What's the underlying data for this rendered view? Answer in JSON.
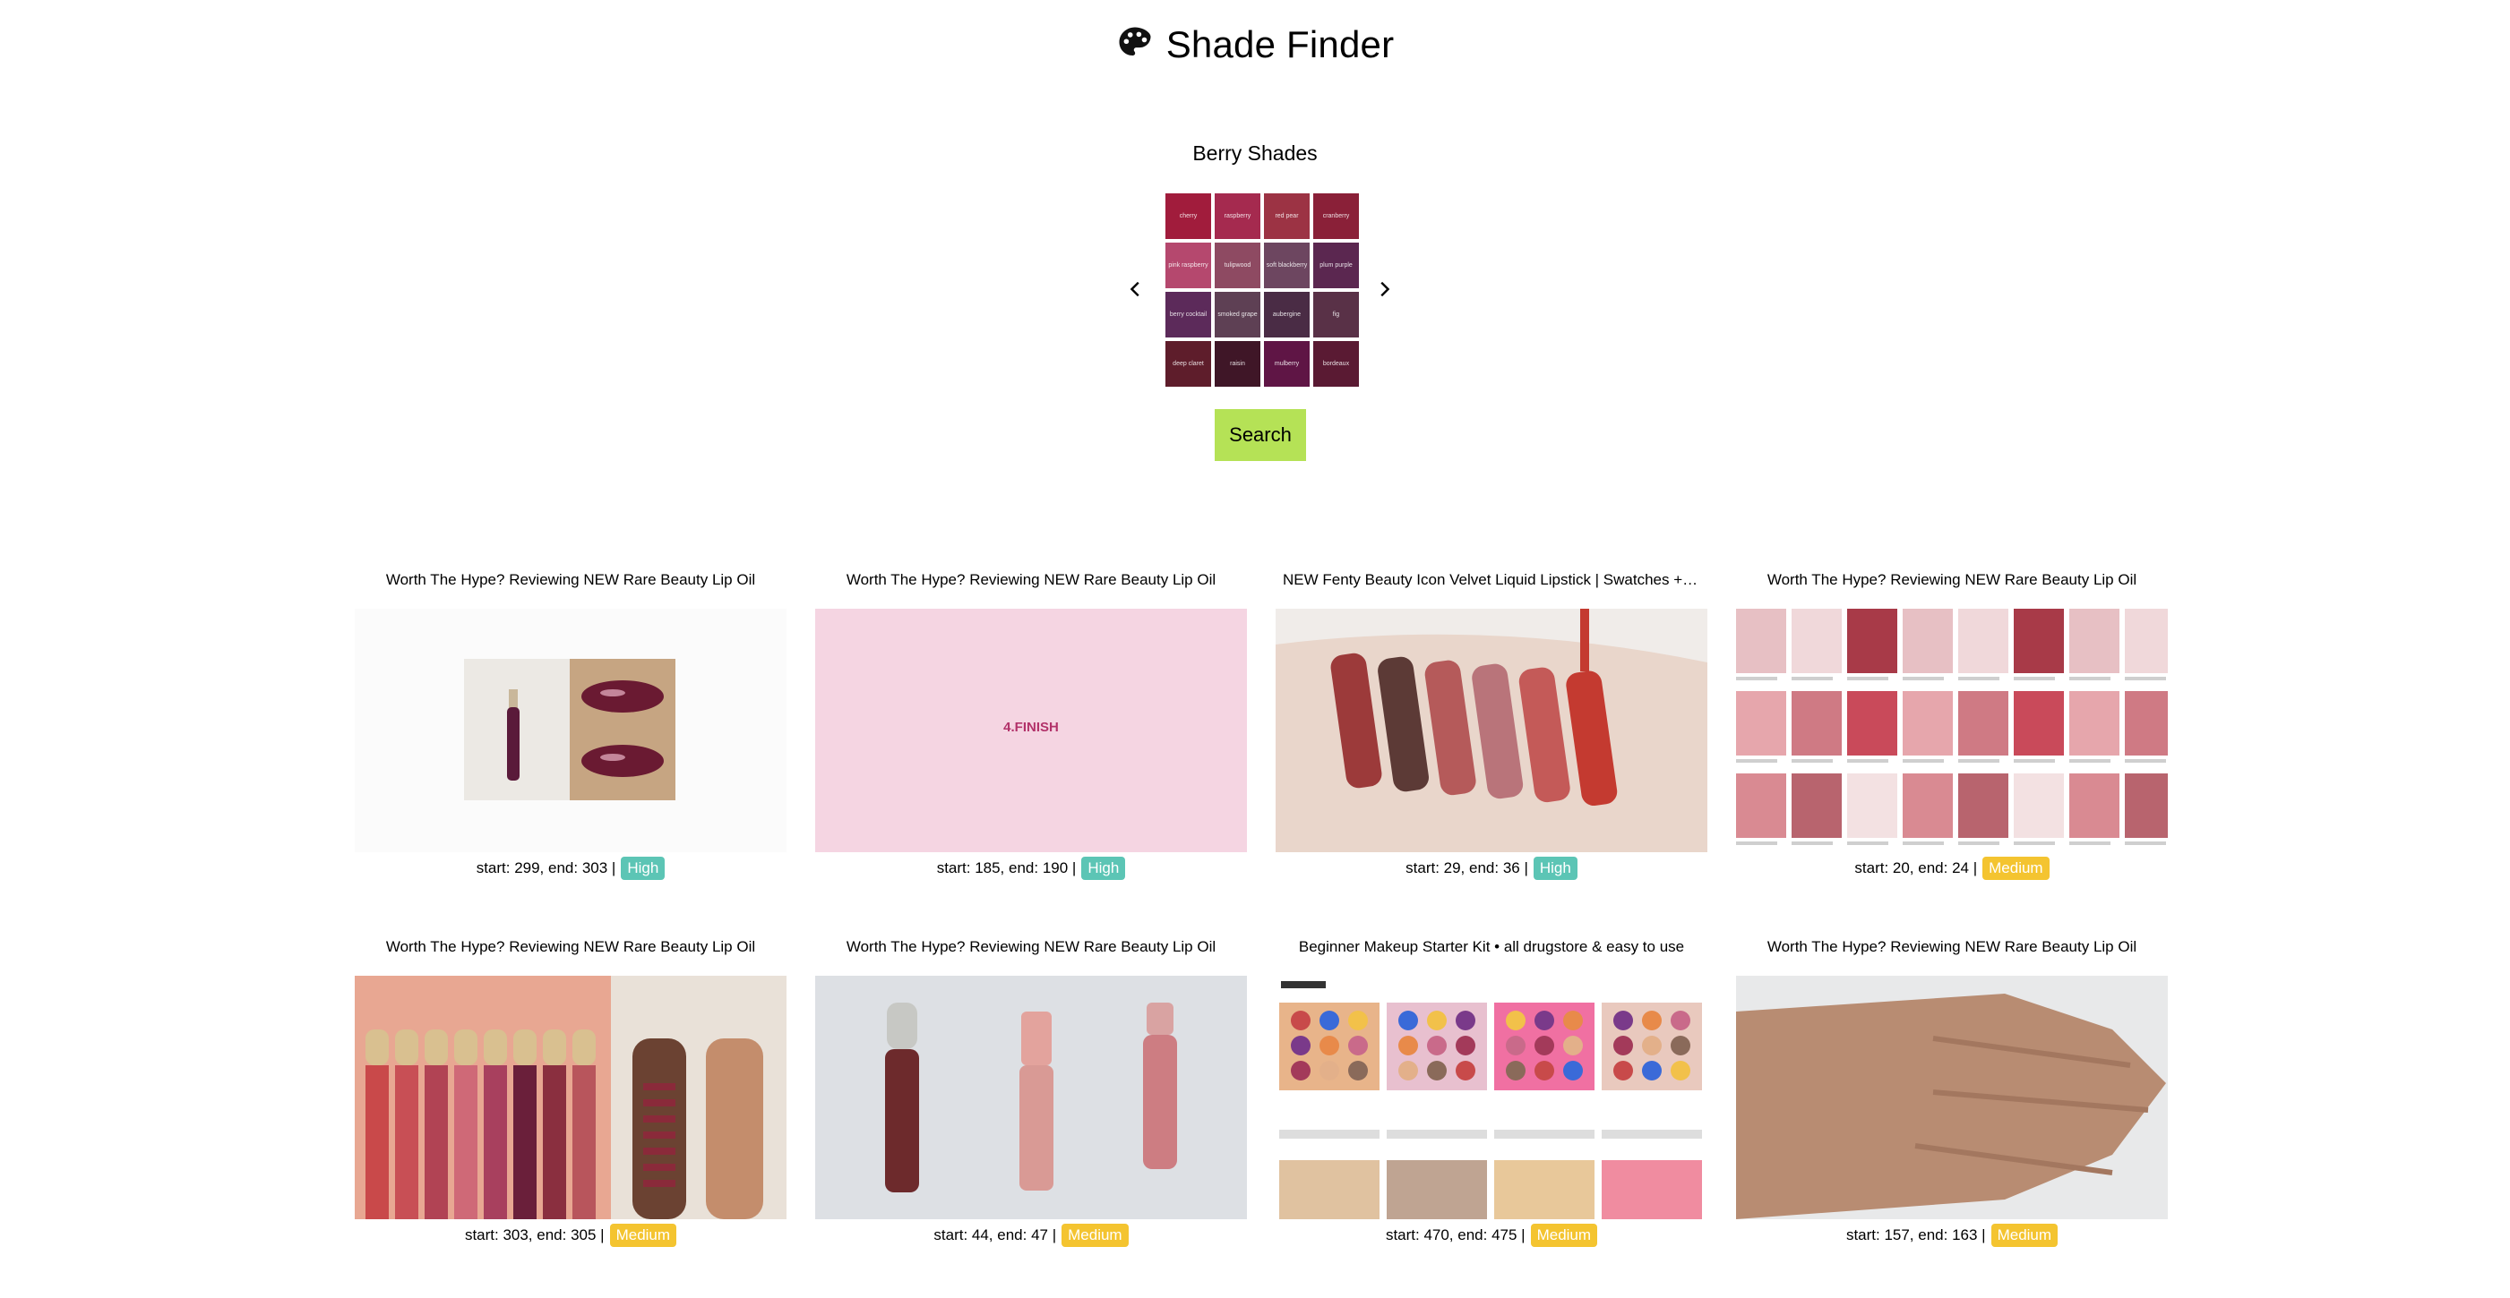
{
  "header": {
    "title": "Shade Finder",
    "icon": "palette-icon"
  },
  "palette": {
    "title": "Berry Shades",
    "swatches": [
      {
        "label": "cherry",
        "color": "#a11c3c"
      },
      {
        "label": "raspberry",
        "color": "#a52a4f"
      },
      {
        "label": "red pear",
        "color": "#9c3344"
      },
      {
        "label": "cranberry",
        "color": "#8a2038"
      },
      {
        "label": "pink raspberry",
        "color": "#b5486e"
      },
      {
        "label": "tulipwood",
        "color": "#8e4a62"
      },
      {
        "label": "soft blackberry",
        "color": "#6d4660"
      },
      {
        "label": "plum purple",
        "color": "#5b2750"
      },
      {
        "label": "berry cocktail",
        "color": "#5c2a5a"
      },
      {
        "label": "smoked grape",
        "color": "#5e4054"
      },
      {
        "label": "aubergine",
        "color": "#4a2c45"
      },
      {
        "label": "fig",
        "color": "#593147"
      },
      {
        "label": "deep claret",
        "color": "#5e1d2b"
      },
      {
        "label": "raisin",
        "color": "#3f1627"
      },
      {
        "label": "mulberry",
        "color": "#5f1545"
      },
      {
        "label": "bordeaux",
        "color": "#5a1a33"
      }
    ]
  },
  "search": {
    "label": "Search"
  },
  "badge_colors": {
    "High": "#5cc5b5",
    "Medium": "#f4c430"
  },
  "results": [
    {
      "title": "Worth The Hype? Reviewing NEW Rare Beauty Lip Oil",
      "meta": "start: 299, end: 303 |",
      "confidence": "High",
      "thumb": "rare-beauty-lip-oil-tube-and-lips"
    },
    {
      "title": "Worth The Hype? Reviewing NEW Rare Beauty Lip Oil",
      "meta": "start: 185, end: 190 |",
      "confidence": "High",
      "thumb": "finish-pink-slide",
      "thumb_text": "4.FINISH"
    },
    {
      "title": "NEW Fenty Beauty Icon Velvet Liquid Lipstick | Swatches + De...",
      "meta": "start: 29, end: 36 |",
      "confidence": "High",
      "thumb": "arm-lipstick-swatches"
    },
    {
      "title": "Worth The Hype? Reviewing NEW Rare Beauty Lip Oil",
      "meta": "start: 20, end: 24 |",
      "confidence": "Medium",
      "thumb": "image-search-grid"
    },
    {
      "title": "Worth The Hype? Reviewing NEW Rare Beauty Lip Oil",
      "meta": "start: 303, end: 305 |",
      "confidence": "Medium",
      "thumb": "rare-beauty-lineup-and-arm-swatches"
    },
    {
      "title": "Worth The Hype? Reviewing NEW Rare Beauty Lip Oil",
      "meta": "start: 44, end: 47 |",
      "confidence": "Medium",
      "thumb": "three-lip-gloss-tubes"
    },
    {
      "title": "Beginner Makeup Starter Kit • all drugstore & easy to use",
      "meta": "start: 470, end: 475 |",
      "confidence": "Medium",
      "thumb": "colourpop-palettes-webpage"
    },
    {
      "title": "Worth The Hype? Reviewing NEW Rare Beauty Lip Oil",
      "meta": "start: 157, end: 163 |",
      "confidence": "Medium",
      "thumb": "hand-on-white-towel"
    }
  ]
}
